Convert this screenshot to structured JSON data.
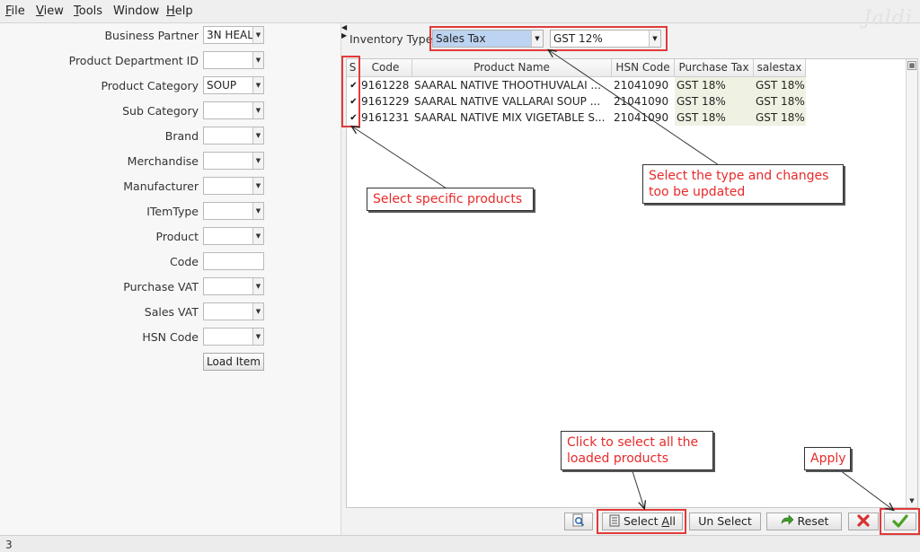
{
  "menu": {
    "items": [
      {
        "mnemonic": "F",
        "rest": "ile"
      },
      {
        "mnemonic": "V",
        "rest": "iew"
      },
      {
        "mnemonic": "T",
        "rest": "ools"
      },
      {
        "mnemonic": "",
        "rest": "Window"
      },
      {
        "mnemonic": "H",
        "rest": "elp"
      }
    ],
    "logo": "Jaldi"
  },
  "filters": {
    "business_partner": {
      "label": "Business Partner",
      "value": "3N HEAL"
    },
    "product_department_id": {
      "label": "Product Department ID",
      "value": ""
    },
    "product_category": {
      "label": "Product Category",
      "value": "SOUP"
    },
    "sub_category": {
      "label": "Sub Category",
      "value": ""
    },
    "brand": {
      "label": "Brand",
      "value": ""
    },
    "merchandise": {
      "label": "Merchandise",
      "value": ""
    },
    "manufacturer": {
      "label": "Manufacturer",
      "value": ""
    },
    "item_type": {
      "label": "ITemType",
      "value": ""
    },
    "product": {
      "label": "Product",
      "value": ""
    },
    "code": {
      "label": "Code",
      "value": ""
    },
    "purchase_vat": {
      "label": "Purchase VAT",
      "value": ""
    },
    "sales_vat": {
      "label": "Sales VAT",
      "value": ""
    },
    "hsn_code": {
      "label": "HSN Code",
      "value": ""
    },
    "load_item_label": "Load Item"
  },
  "inventory": {
    "label": "Inventory Type",
    "type_value": "Sales Tax",
    "tax_value": "GST 12%"
  },
  "grid": {
    "columns": [
      "S",
      "Code",
      "Product Name",
      "HSN Code",
      "Purchase Tax",
      "salestax"
    ],
    "rows": [
      {
        "checked": "✔",
        "code": "9161228",
        "name": "SAARAL NATIVE THOOTHUVALAI ...",
        "hsn": "21041090",
        "purchase_tax": "GST 18%",
        "sales_tax": "GST 18%"
      },
      {
        "checked": "✔",
        "code": "9161229",
        "name": "SAARAL NATIVE  VALLARAI SOUP ...",
        "hsn": "21041090",
        "purchase_tax": "GST 18%",
        "sales_tax": "GST 18%"
      },
      {
        "checked": "✔",
        "code": "9161231",
        "name": "SAARAL NATIVE MIX VIGETABLE S...",
        "hsn": "21041090",
        "purchase_tax": "GST 18%",
        "sales_tax": "GST 18%"
      }
    ]
  },
  "buttons": {
    "select_all": {
      "pre": "Select ",
      "mnemonic": "A",
      "post": "ll"
    },
    "unselect": "Un Select",
    "reset": "Reset"
  },
  "status": {
    "count": "3"
  },
  "annotations": {
    "select_products": "Select specific products",
    "select_type": "Select the type and changes\n too be updated",
    "select_all": "Click to select all the\nloaded products",
    "apply": "Apply"
  },
  "colors": {
    "annotation_red": "#e82a2a",
    "apply_check": "#4aa320",
    "close_x": "#d93030"
  }
}
